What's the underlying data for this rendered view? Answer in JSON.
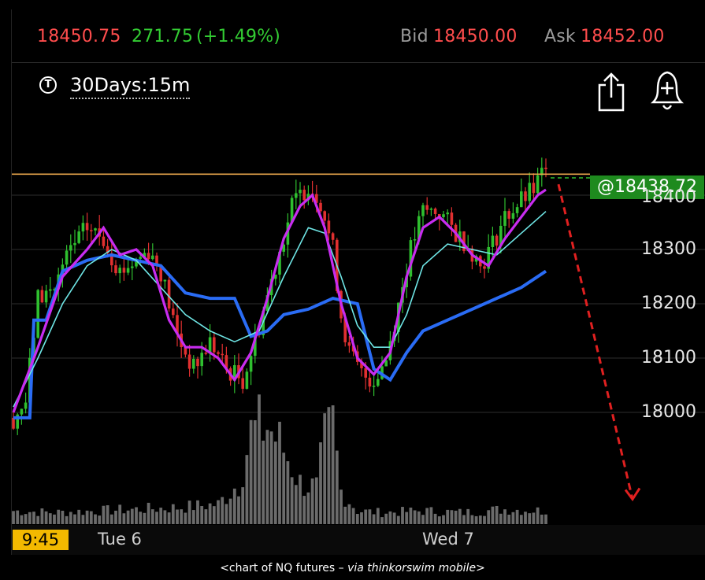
{
  "quote": {
    "last": "18450.75",
    "change": "271.75",
    "change_pct": "(+1.49%)",
    "bid_label": "Bid",
    "bid": "18450.00",
    "ask_label": "Ask",
    "ask": "18452.00"
  },
  "toolbar": {
    "timeframe": "30Days:15m",
    "t_icon": "T",
    "share_icon": "share-icon",
    "alert_icon": "bell-plus-icon"
  },
  "price_tag": "@18438.72",
  "colors": {
    "up": "#2fbf2f",
    "down": "#e03030",
    "ma_fast": "#c82cf0",
    "ma_mid": "#6fe6e6",
    "ma_slow": "#2a6cf5",
    "resistance": "#e9a64b",
    "projection": "#e02020",
    "volume": "#6b6b6b",
    "tag_bg": "#1e8a1e"
  },
  "time_now": "9:45",
  "caption_parts": {
    "open": "<chart of NQ futures – ",
    "source": "via thinkorswim mobile",
    "close": ">"
  },
  "chart_data": {
    "type": "candlestick",
    "y_ticks": [
      "18000",
      "18100",
      "18200",
      "18300",
      "18400"
    ],
    "x_ticks": [
      "Tue 6",
      "Wed 7"
    ],
    "ylim": [
      17960,
      18520
    ],
    "resistance_level": 18438.72,
    "projection": {
      "from": 18420,
      "to": 17840
    },
    "price_path": [
      [
        0,
        17990
      ],
      [
        3,
        18020
      ],
      [
        6,
        18210
      ],
      [
        10,
        18230
      ],
      [
        14,
        18300
      ],
      [
        18,
        18340
      ],
      [
        22,
        18320
      ],
      [
        26,
        18260
      ],
      [
        30,
        18280
      ],
      [
        33,
        18300
      ],
      [
        36,
        18260
      ],
      [
        40,
        18140
      ],
      [
        44,
        18080
      ],
      [
        48,
        18130
      ],
      [
        52,
        18080
      ],
      [
        56,
        18060
      ],
      [
        60,
        18160
      ],
      [
        64,
        18270
      ],
      [
        68,
        18380
      ],
      [
        72,
        18420
      ],
      [
        75,
        18390
      ],
      [
        78,
        18300
      ],
      [
        80,
        18180
      ],
      [
        82,
        18110
      ],
      [
        85,
        18070
      ],
      [
        88,
        18060
      ],
      [
        91,
        18100
      ],
      [
        94,
        18200
      ],
      [
        97,
        18300
      ],
      [
        100,
        18370
      ],
      [
        104,
        18370
      ],
      [
        108,
        18330
      ],
      [
        111,
        18310
      ],
      [
        114,
        18270
      ],
      [
        117,
        18310
      ],
      [
        120,
        18360
      ],
      [
        124,
        18390
      ],
      [
        127,
        18410
      ],
      [
        129,
        18438
      ]
    ],
    "ma_fast": [
      [
        0,
        18000
      ],
      [
        6,
        18120
      ],
      [
        12,
        18250
      ],
      [
        18,
        18300
      ],
      [
        22,
        18340
      ],
      [
        26,
        18290
      ],
      [
        30,
        18300
      ],
      [
        34,
        18270
      ],
      [
        38,
        18170
      ],
      [
        42,
        18120
      ],
      [
        46,
        18120
      ],
      [
        50,
        18100
      ],
      [
        54,
        18060
      ],
      [
        58,
        18110
      ],
      [
        62,
        18210
      ],
      [
        66,
        18320
      ],
      [
        70,
        18380
      ],
      [
        73,
        18400
      ],
      [
        76,
        18340
      ],
      [
        80,
        18200
      ],
      [
        84,
        18100
      ],
      [
        88,
        18070
      ],
      [
        92,
        18110
      ],
      [
        96,
        18250
      ],
      [
        100,
        18340
      ],
      [
        104,
        18360
      ],
      [
        108,
        18330
      ],
      [
        112,
        18290
      ],
      [
        116,
        18270
      ],
      [
        120,
        18320
      ],
      [
        124,
        18360
      ],
      [
        128,
        18400
      ],
      [
        130,
        18410
      ]
    ],
    "ma_mid": [
      [
        0,
        18010
      ],
      [
        6,
        18100
      ],
      [
        12,
        18200
      ],
      [
        18,
        18270
      ],
      [
        24,
        18300
      ],
      [
        30,
        18280
      ],
      [
        36,
        18230
      ],
      [
        42,
        18180
      ],
      [
        48,
        18150
      ],
      [
        54,
        18130
      ],
      [
        60,
        18150
      ],
      [
        66,
        18250
      ],
      [
        72,
        18340
      ],
      [
        76,
        18330
      ],
      [
        80,
        18250
      ],
      [
        84,
        18160
      ],
      [
        88,
        18120
      ],
      [
        92,
        18120
      ],
      [
        96,
        18180
      ],
      [
        100,
        18270
      ],
      [
        106,
        18310
      ],
      [
        112,
        18300
      ],
      [
        118,
        18290
      ],
      [
        124,
        18330
      ],
      [
        130,
        18370
      ]
    ],
    "ma_slow": [
      [
        0,
        17990
      ],
      [
        4,
        17990
      ],
      [
        5,
        18170
      ],
      [
        8,
        18170
      ],
      [
        12,
        18260
      ],
      [
        18,
        18280
      ],
      [
        24,
        18290
      ],
      [
        30,
        18280
      ],
      [
        36,
        18270
      ],
      [
        42,
        18220
      ],
      [
        48,
        18210
      ],
      [
        54,
        18210
      ],
      [
        58,
        18140
      ],
      [
        62,
        18150
      ],
      [
        66,
        18180
      ],
      [
        72,
        18190
      ],
      [
        78,
        18210
      ],
      [
        84,
        18200
      ],
      [
        88,
        18080
      ],
      [
        92,
        18060
      ],
      [
        96,
        18110
      ],
      [
        100,
        18150
      ],
      [
        106,
        18170
      ],
      [
        112,
        18190
      ],
      [
        118,
        18210
      ],
      [
        124,
        18230
      ],
      [
        130,
        18260
      ]
    ],
    "volume_profile": [
      [
        0,
        0.08
      ],
      [
        10,
        0.07
      ],
      [
        20,
        0.08
      ],
      [
        30,
        0.09
      ],
      [
        40,
        0.1
      ],
      [
        50,
        0.12
      ],
      [
        55,
        0.25
      ],
      [
        58,
        0.55
      ],
      [
        62,
        0.6
      ],
      [
        66,
        0.45
      ],
      [
        70,
        0.25
      ],
      [
        74,
        0.22
      ],
      [
        76,
        0.5
      ],
      [
        78,
        0.6
      ],
      [
        80,
        0.2
      ],
      [
        84,
        0.08
      ],
      [
        90,
        0.07
      ],
      [
        100,
        0.08
      ],
      [
        110,
        0.07
      ],
      [
        120,
        0.09
      ],
      [
        130,
        0.08
      ]
    ]
  }
}
